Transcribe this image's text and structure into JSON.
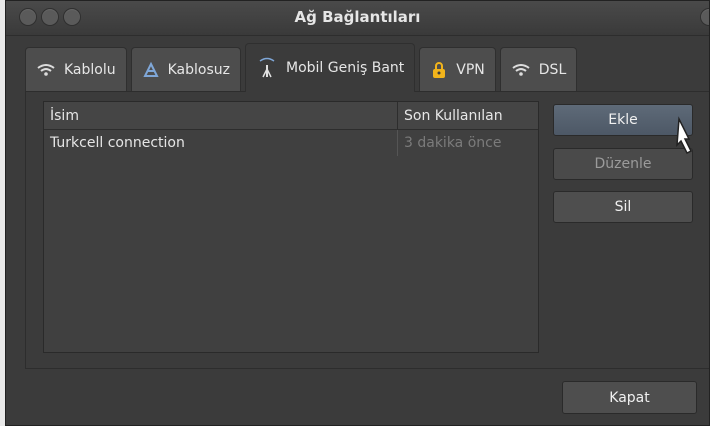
{
  "window": {
    "title": "Ağ Bağlantıları"
  },
  "tabs": [
    {
      "label": "Kablolu",
      "icon": "wifi-icon"
    },
    {
      "label": "Kablosuz",
      "icon": "wireless-antenna-icon"
    },
    {
      "label": "Mobil Geniş Bant",
      "icon": "mobile-antenna-icon",
      "active": true
    },
    {
      "label": "VPN",
      "icon": "lock-icon"
    },
    {
      "label": "DSL",
      "icon": "wifi-icon"
    }
  ],
  "list": {
    "columns": [
      "İsim",
      "Son Kullanılan"
    ],
    "rows": [
      {
        "name": "Turkcell connection",
        "last_used": "3 dakika önce"
      }
    ]
  },
  "buttons": {
    "add": "Ekle",
    "edit": "Düzenle",
    "delete": "Sil",
    "close": "Kapat"
  }
}
